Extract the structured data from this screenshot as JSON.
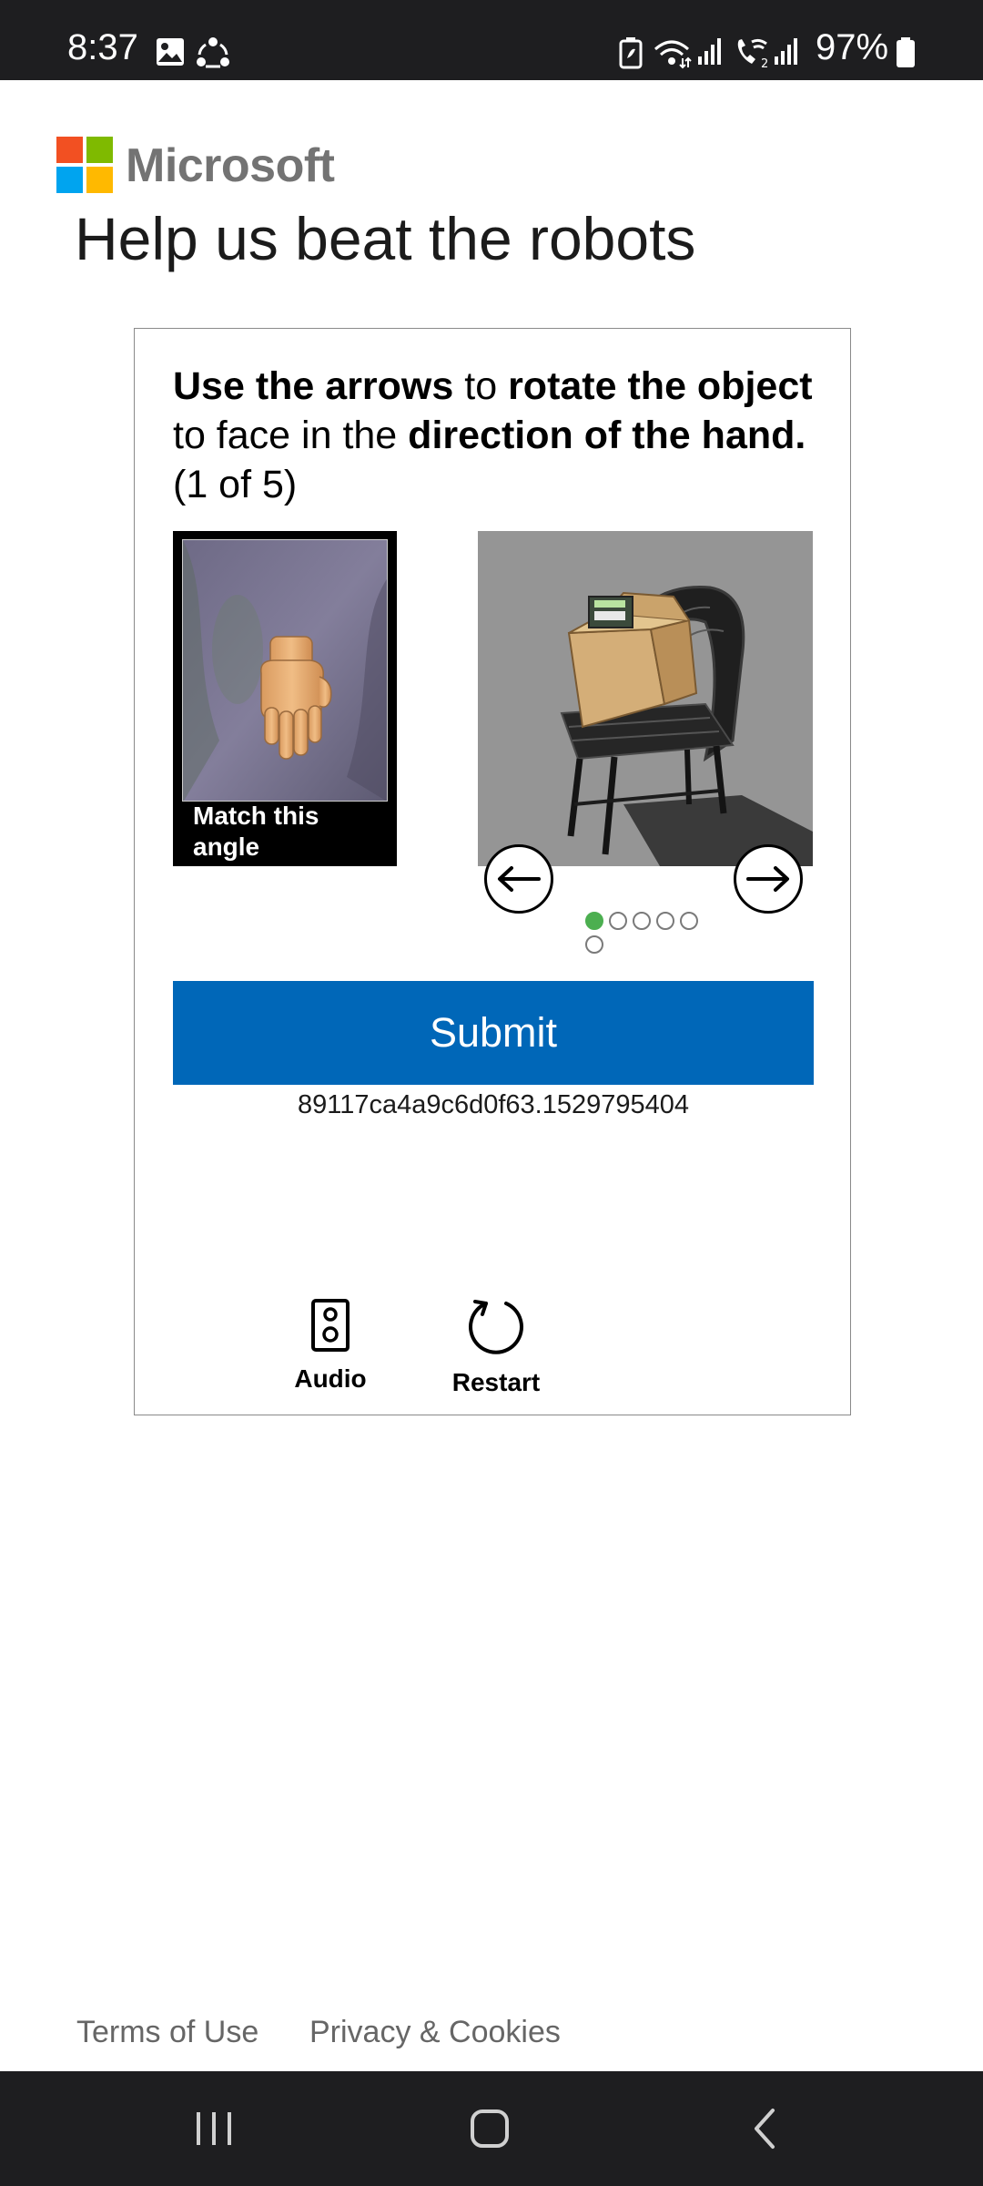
{
  "status_bar": {
    "time": "8:37",
    "battery_percent": "97%",
    "icons": [
      "image-notification-icon",
      "sync-notification-icon",
      "battery-saver-icon",
      "wifi-icon",
      "signal-icon",
      "wifi-calling-icon",
      "signal-2-icon",
      "battery-icon"
    ]
  },
  "header": {
    "brand": "Microsoft",
    "title": "Help us beat the robots"
  },
  "challenge": {
    "instruction_parts": [
      {
        "text": "Use the arrows",
        "bold": true
      },
      {
        "text": " to ",
        "bold": false
      },
      {
        "text": "rotate the object",
        "bold": true
      },
      {
        "text": " to face in the ",
        "bold": false
      },
      {
        "text": "direction of the hand.",
        "bold": true
      },
      {
        "text": " (1 of 5)",
        "bold": false
      }
    ],
    "reference_caption": "Match this angle",
    "current_step": 1,
    "total_steps": 5,
    "carousel_dots": 6,
    "active_dot": 1,
    "submit_label": "Submit",
    "session_id": "89117ca4a9c6d0f63.1529795404",
    "audio_label": "Audio",
    "restart_label": "Restart"
  },
  "footer": {
    "terms": "Terms of Use",
    "privacy": "Privacy & Cookies"
  },
  "nav_bar": {
    "icons": [
      "recent-apps-icon",
      "home-icon",
      "back-icon"
    ]
  },
  "colors": {
    "status_bar_bg": "#1e1e20",
    "submit_bg": "#0067b8",
    "active_dot": "#4caf50",
    "logo_red": "#f25022",
    "logo_green": "#7fba00",
    "logo_blue": "#00a4ef",
    "logo_yellow": "#ffb900"
  }
}
